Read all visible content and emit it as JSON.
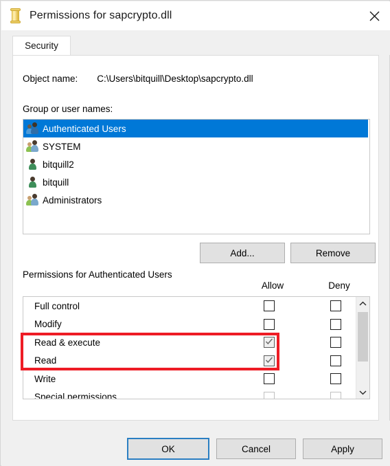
{
  "window": {
    "title": "Permissions for sapcrypto.dll",
    "icon": "scroll-icon",
    "close_label": "✕"
  },
  "tabs": [
    {
      "label": "Security",
      "active": true
    }
  ],
  "object": {
    "label": "Object name:",
    "value": "C:\\Users\\bitquill\\Desktop\\sapcrypto.dll"
  },
  "group_section": {
    "label": "Group or user names:",
    "items": [
      {
        "name": "Authenticated Users",
        "icon": "group-icon",
        "selected": true
      },
      {
        "name": "SYSTEM",
        "icon": "group-icon",
        "selected": false
      },
      {
        "name": "bitquill2",
        "icon": "user-icon",
        "selected": false
      },
      {
        "name": "bitquill",
        "icon": "user-icon",
        "selected": false
      },
      {
        "name": "Administrators",
        "icon": "group-icon",
        "selected": false
      }
    ],
    "add_label": "Add...",
    "remove_label": "Remove"
  },
  "permissions_section": {
    "label": "Permissions for Authenticated Users",
    "allow_header": "Allow",
    "deny_header": "Deny",
    "rows": [
      {
        "name": "Full control",
        "allow": false,
        "deny": false,
        "dim": false,
        "highlighted": false
      },
      {
        "name": "Modify",
        "allow": false,
        "deny": false,
        "dim": false,
        "highlighted": false
      },
      {
        "name": "Read & execute",
        "allow": true,
        "deny": false,
        "dim": false,
        "highlighted": true
      },
      {
        "name": "Read",
        "allow": true,
        "deny": false,
        "dim": false,
        "highlighted": true
      },
      {
        "name": "Write",
        "allow": false,
        "deny": false,
        "dim": false,
        "highlighted": false
      },
      {
        "name": "Special permissions",
        "allow": false,
        "deny": false,
        "dim": true,
        "highlighted": false
      }
    ],
    "scroll_up": "⌃",
    "scroll_down": "⌄"
  },
  "footer": {
    "ok_label": "OK",
    "cancel_label": "Cancel",
    "apply_label": "Apply"
  },
  "colors": {
    "selection_blue": "#0078d7",
    "annotation_red": "#ee1c25",
    "focus_blue": "#2a7ec2",
    "dialog_bg": "#f0f0f0"
  }
}
